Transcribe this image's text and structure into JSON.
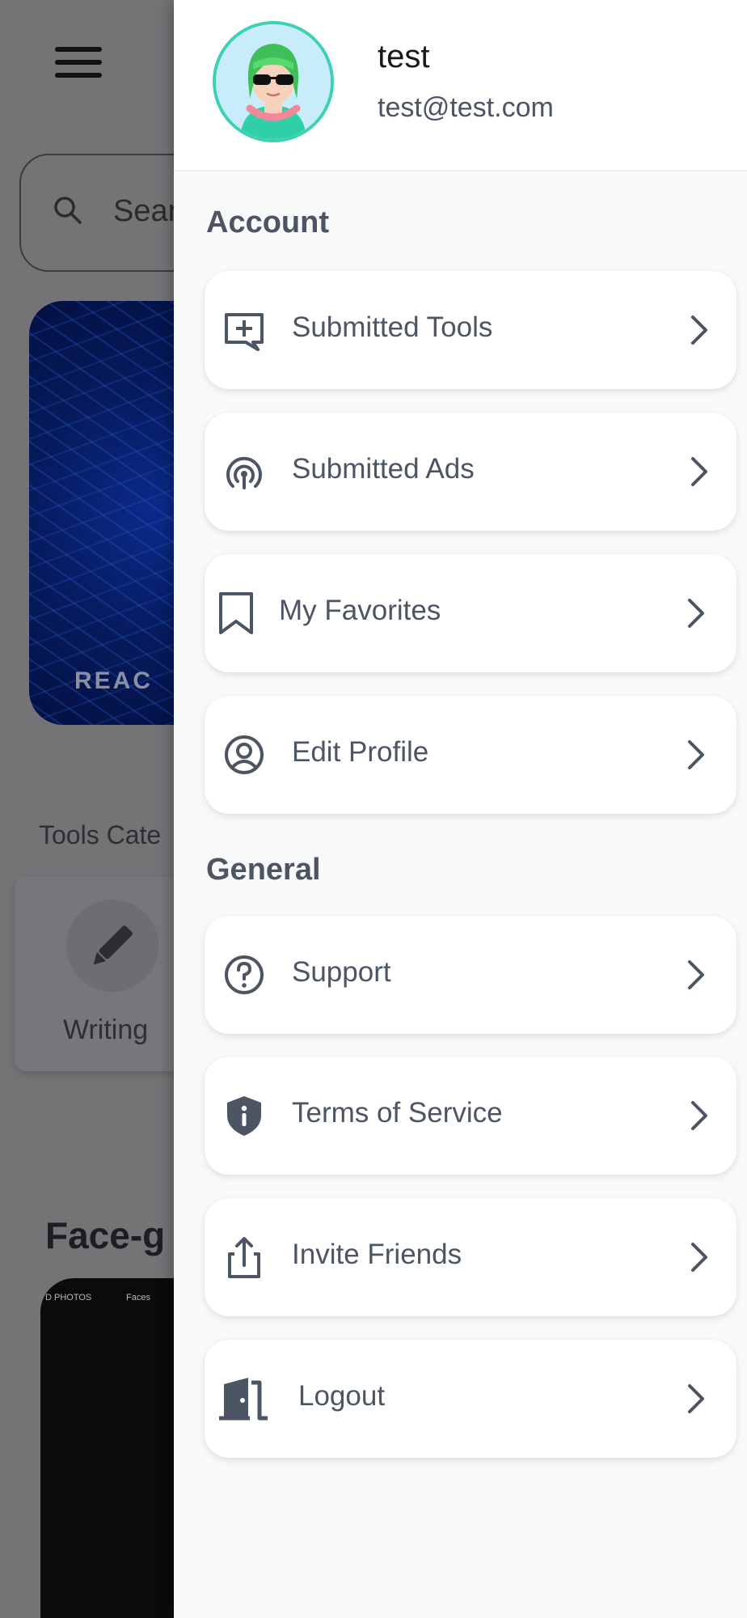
{
  "background": {
    "search_placeholder": "Sear",
    "banner_text": "REAC",
    "section_label": "Tools Cate",
    "category_label": "Writing",
    "heading": "Face-g",
    "video_labels": [
      "D PHOTOS",
      "Faces"
    ]
  },
  "drawer": {
    "user": {
      "name": "test",
      "email": "test@test.com"
    },
    "sections": [
      {
        "title": "Account"
      },
      {
        "title": "General"
      }
    ],
    "items": [
      {
        "label": "Submitted Tools",
        "icon": "add-comment-icon"
      },
      {
        "label": "Submitted Ads",
        "icon": "broadcast-icon"
      },
      {
        "label": "My Favorites",
        "icon": "bookmark-icon"
      },
      {
        "label": "Edit Profile",
        "icon": "user-circle-icon"
      },
      {
        "label": "Support",
        "icon": "help-circle-icon"
      },
      {
        "label": "Terms of Service",
        "icon": "shield-info-icon"
      },
      {
        "label": "Invite Friends",
        "icon": "share-icon"
      },
      {
        "label": "Logout",
        "icon": "door-exit-icon"
      }
    ]
  },
  "colors": {
    "accent": "#3bd1b2",
    "text": "#4b5563",
    "drawer_bg": "#f8f9f9"
  }
}
